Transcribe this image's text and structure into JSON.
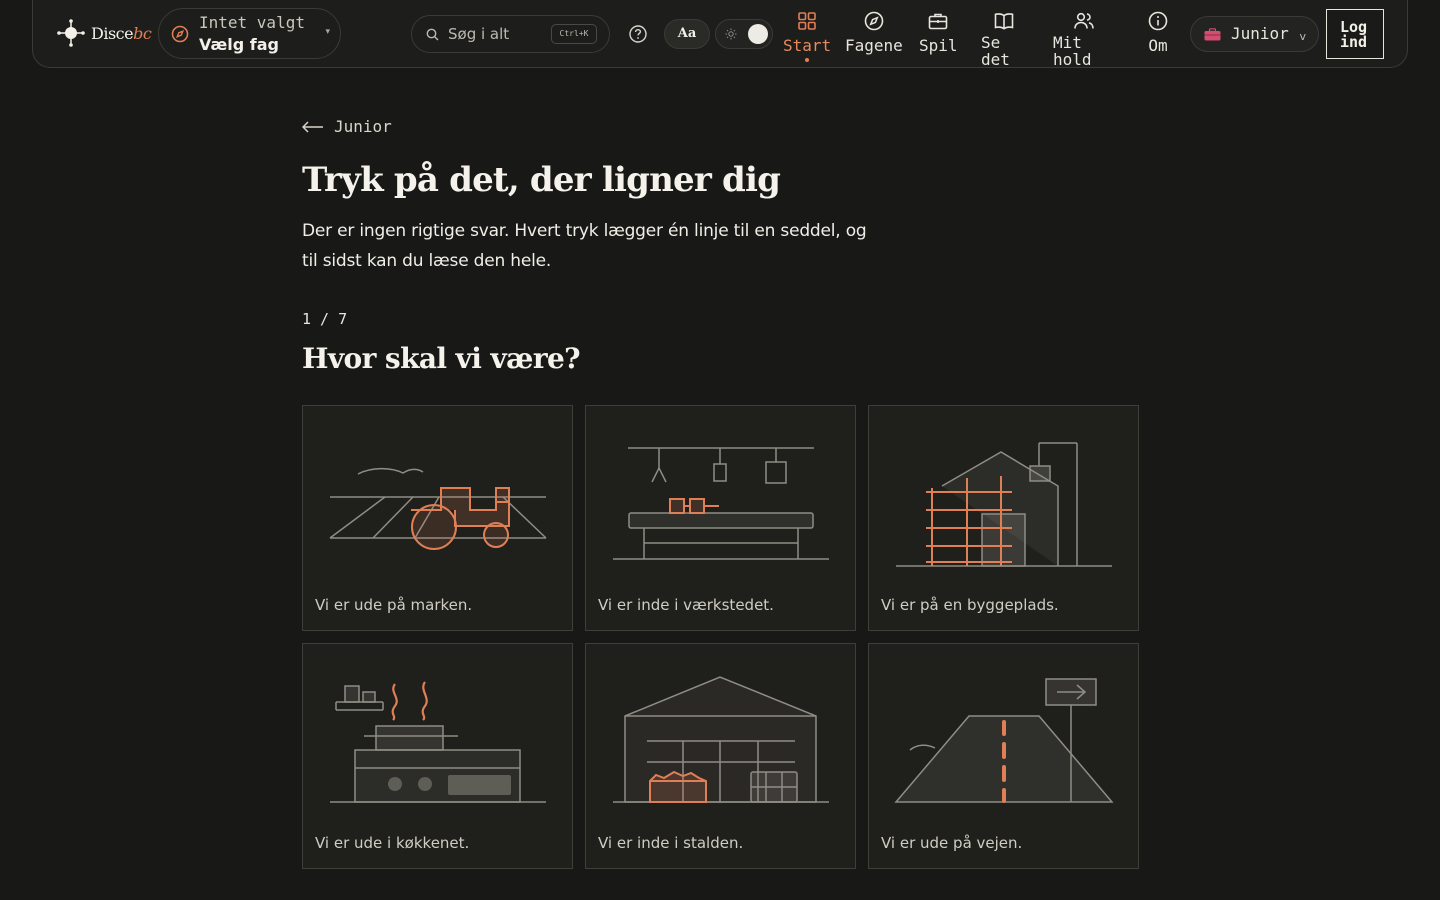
{
  "header": {
    "logo": {
      "name": "Disce",
      "suffix": "bc"
    },
    "subject": {
      "status": "Intet valgt",
      "action": "Vælg fag"
    },
    "search": {
      "placeholder": "Søg i alt",
      "shortcut": "Ctrl+K"
    },
    "font_toggle_label": "Aa",
    "nav": [
      {
        "label": "Start",
        "icon": "grid-icon",
        "active": true
      },
      {
        "label": "Fagene",
        "icon": "compass-icon"
      },
      {
        "label": "Spil",
        "icon": "briefcase-icon"
      },
      {
        "label": "Se\ndet",
        "icon": "book-icon"
      },
      {
        "label": "Mit\nhold",
        "icon": "people-icon"
      },
      {
        "label": "Om",
        "icon": "info-icon"
      }
    ],
    "level": {
      "label": "Junior"
    },
    "login_label": "Log\nind"
  },
  "main": {
    "back_label": "Junior",
    "title": "Tryk på det, der ligner dig",
    "intro": "Der er ingen rigtige svar. Hvert tryk lægger én linje til en seddel, og til sidst kan du læse den hele.",
    "step": "1 / 7",
    "question": "Hvor skal vi være?",
    "options": [
      {
        "label": "Vi er ude på marken.",
        "illustration": "tractor-field"
      },
      {
        "label": "Vi er inde i værkstedet.",
        "illustration": "workshop-bench"
      },
      {
        "label": "Vi er på en byggeplads.",
        "illustration": "construction-scaffold"
      },
      {
        "label": "Vi er ude i køkkenet.",
        "illustration": "kitchen-stove"
      },
      {
        "label": "Vi er inde i stalden.",
        "illustration": "barn"
      },
      {
        "label": "Vi er ude på vejen.",
        "illustration": "road-sign"
      }
    ]
  },
  "colors": {
    "background": "#181816",
    "accent": "#e07f56",
    "line": "#8f8d84",
    "card_border": "#3f3f3a"
  }
}
